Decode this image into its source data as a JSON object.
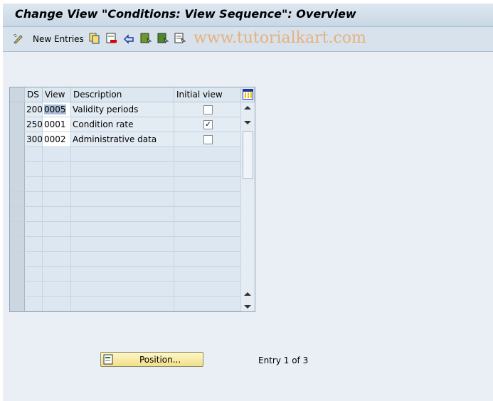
{
  "title": "Change View \"Conditions: View Sequence\": Overview",
  "toolbar": {
    "new_entries": "New Entries",
    "watermark": "www.tutorialkart.com"
  },
  "table": {
    "headers": [
      "DS",
      "View",
      "Description",
      "Initial view"
    ],
    "rows": [
      {
        "ds": "200",
        "view": "0005",
        "description": "Validity periods",
        "initial": false
      },
      {
        "ds": "250",
        "view": "0001",
        "description": "Condition rate",
        "initial": true
      },
      {
        "ds": "300",
        "view": "0002",
        "description": "Administrative data",
        "initial": false
      }
    ]
  },
  "footer": {
    "position_label": "Position...",
    "entry_text": "Entry 1 of 3"
  }
}
